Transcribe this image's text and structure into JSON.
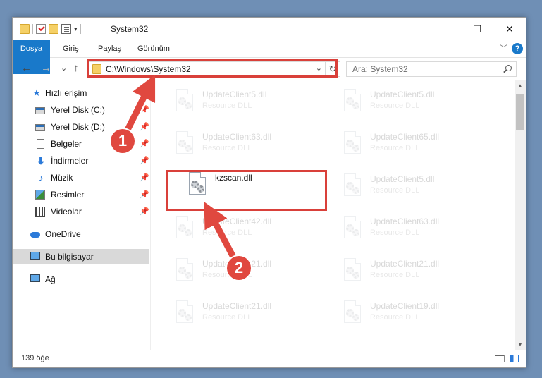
{
  "titlebar": {
    "title": "System32",
    "minimize_glyph": "—",
    "maximize_glyph": "☐",
    "close_glyph": "✕",
    "qat_dropdown_glyph": "▾"
  },
  "ribbon": {
    "tabs": [
      "Dosya",
      "Giriş",
      "Paylaş",
      "Görünüm"
    ],
    "expand_glyph": "﹀",
    "help_glyph": "?"
  },
  "nav": {
    "back_glyph": "←",
    "forward_glyph": "→",
    "recent_glyph": "⌄",
    "up_glyph": "↑",
    "address": "C:\\Windows\\System32",
    "address_dropdown_glyph": "⌄",
    "refresh_glyph": "↻",
    "search_placeholder": "Ara: System32"
  },
  "sidebar": {
    "pin_glyph": "📌",
    "items": [
      {
        "label": "Hızlı erişim",
        "icon": "star-icon"
      },
      {
        "label": "Yerel Disk (C:)",
        "icon": "drive-icon",
        "pinned": true
      },
      {
        "label": "Yerel Disk (D:)",
        "icon": "drive-icon",
        "pinned": true
      },
      {
        "label": "Belgeler",
        "icon": "documents-icon",
        "pinned": true
      },
      {
        "label": "İndirmeler",
        "icon": "downloads-icon",
        "pinned": true
      },
      {
        "label": "Müzik",
        "icon": "music-icon",
        "pinned": true
      },
      {
        "label": "Resimler",
        "icon": "pictures-icon",
        "pinned": true
      },
      {
        "label": "Videolar",
        "icon": "videos-icon",
        "pinned": true
      },
      {
        "label": "OneDrive",
        "icon": "onedrive-icon"
      },
      {
        "label": "Bu bilgisayar",
        "icon": "this-pc-icon",
        "selected": true
      },
      {
        "label": "Ağ",
        "icon": "network-icon"
      }
    ]
  },
  "files": [
    {
      "name": "UpdateClient5.dll",
      "type": "Resource DLL"
    },
    {
      "name": "UpdateClient5.dll",
      "type": "Resource DLL"
    },
    {
      "name": "UpdateClient63.dll",
      "type": "Resource DLL"
    },
    {
      "name": "UpdateClient65.dll",
      "type": "Resource DLL"
    },
    {
      "name": "kzscan.dll",
      "type": ""
    },
    {
      "name": "UpdateClient5.dll",
      "type": "Resource DLL"
    },
    {
      "name": "UpdateClient42.dll",
      "type": "Resource DLL"
    },
    {
      "name": "UpdateClient63.dll",
      "type": "Resource DLL"
    },
    {
      "name": "UpdateClient21.dll",
      "type": "Resource DLL"
    },
    {
      "name": "UpdateClient21.dll",
      "type": "Resource DLL"
    },
    {
      "name": "UpdateClient21.dll",
      "type": "Resource DLL"
    },
    {
      "name": "UpdateClient19.dll",
      "type": "Resource DLL"
    }
  ],
  "scrollbar": {
    "up_glyph": "▲",
    "down_glyph": "▼"
  },
  "status": {
    "item_count": "139 öğe"
  },
  "annotations": {
    "step1": "1",
    "step2": "2",
    "color": "#d9403a"
  }
}
